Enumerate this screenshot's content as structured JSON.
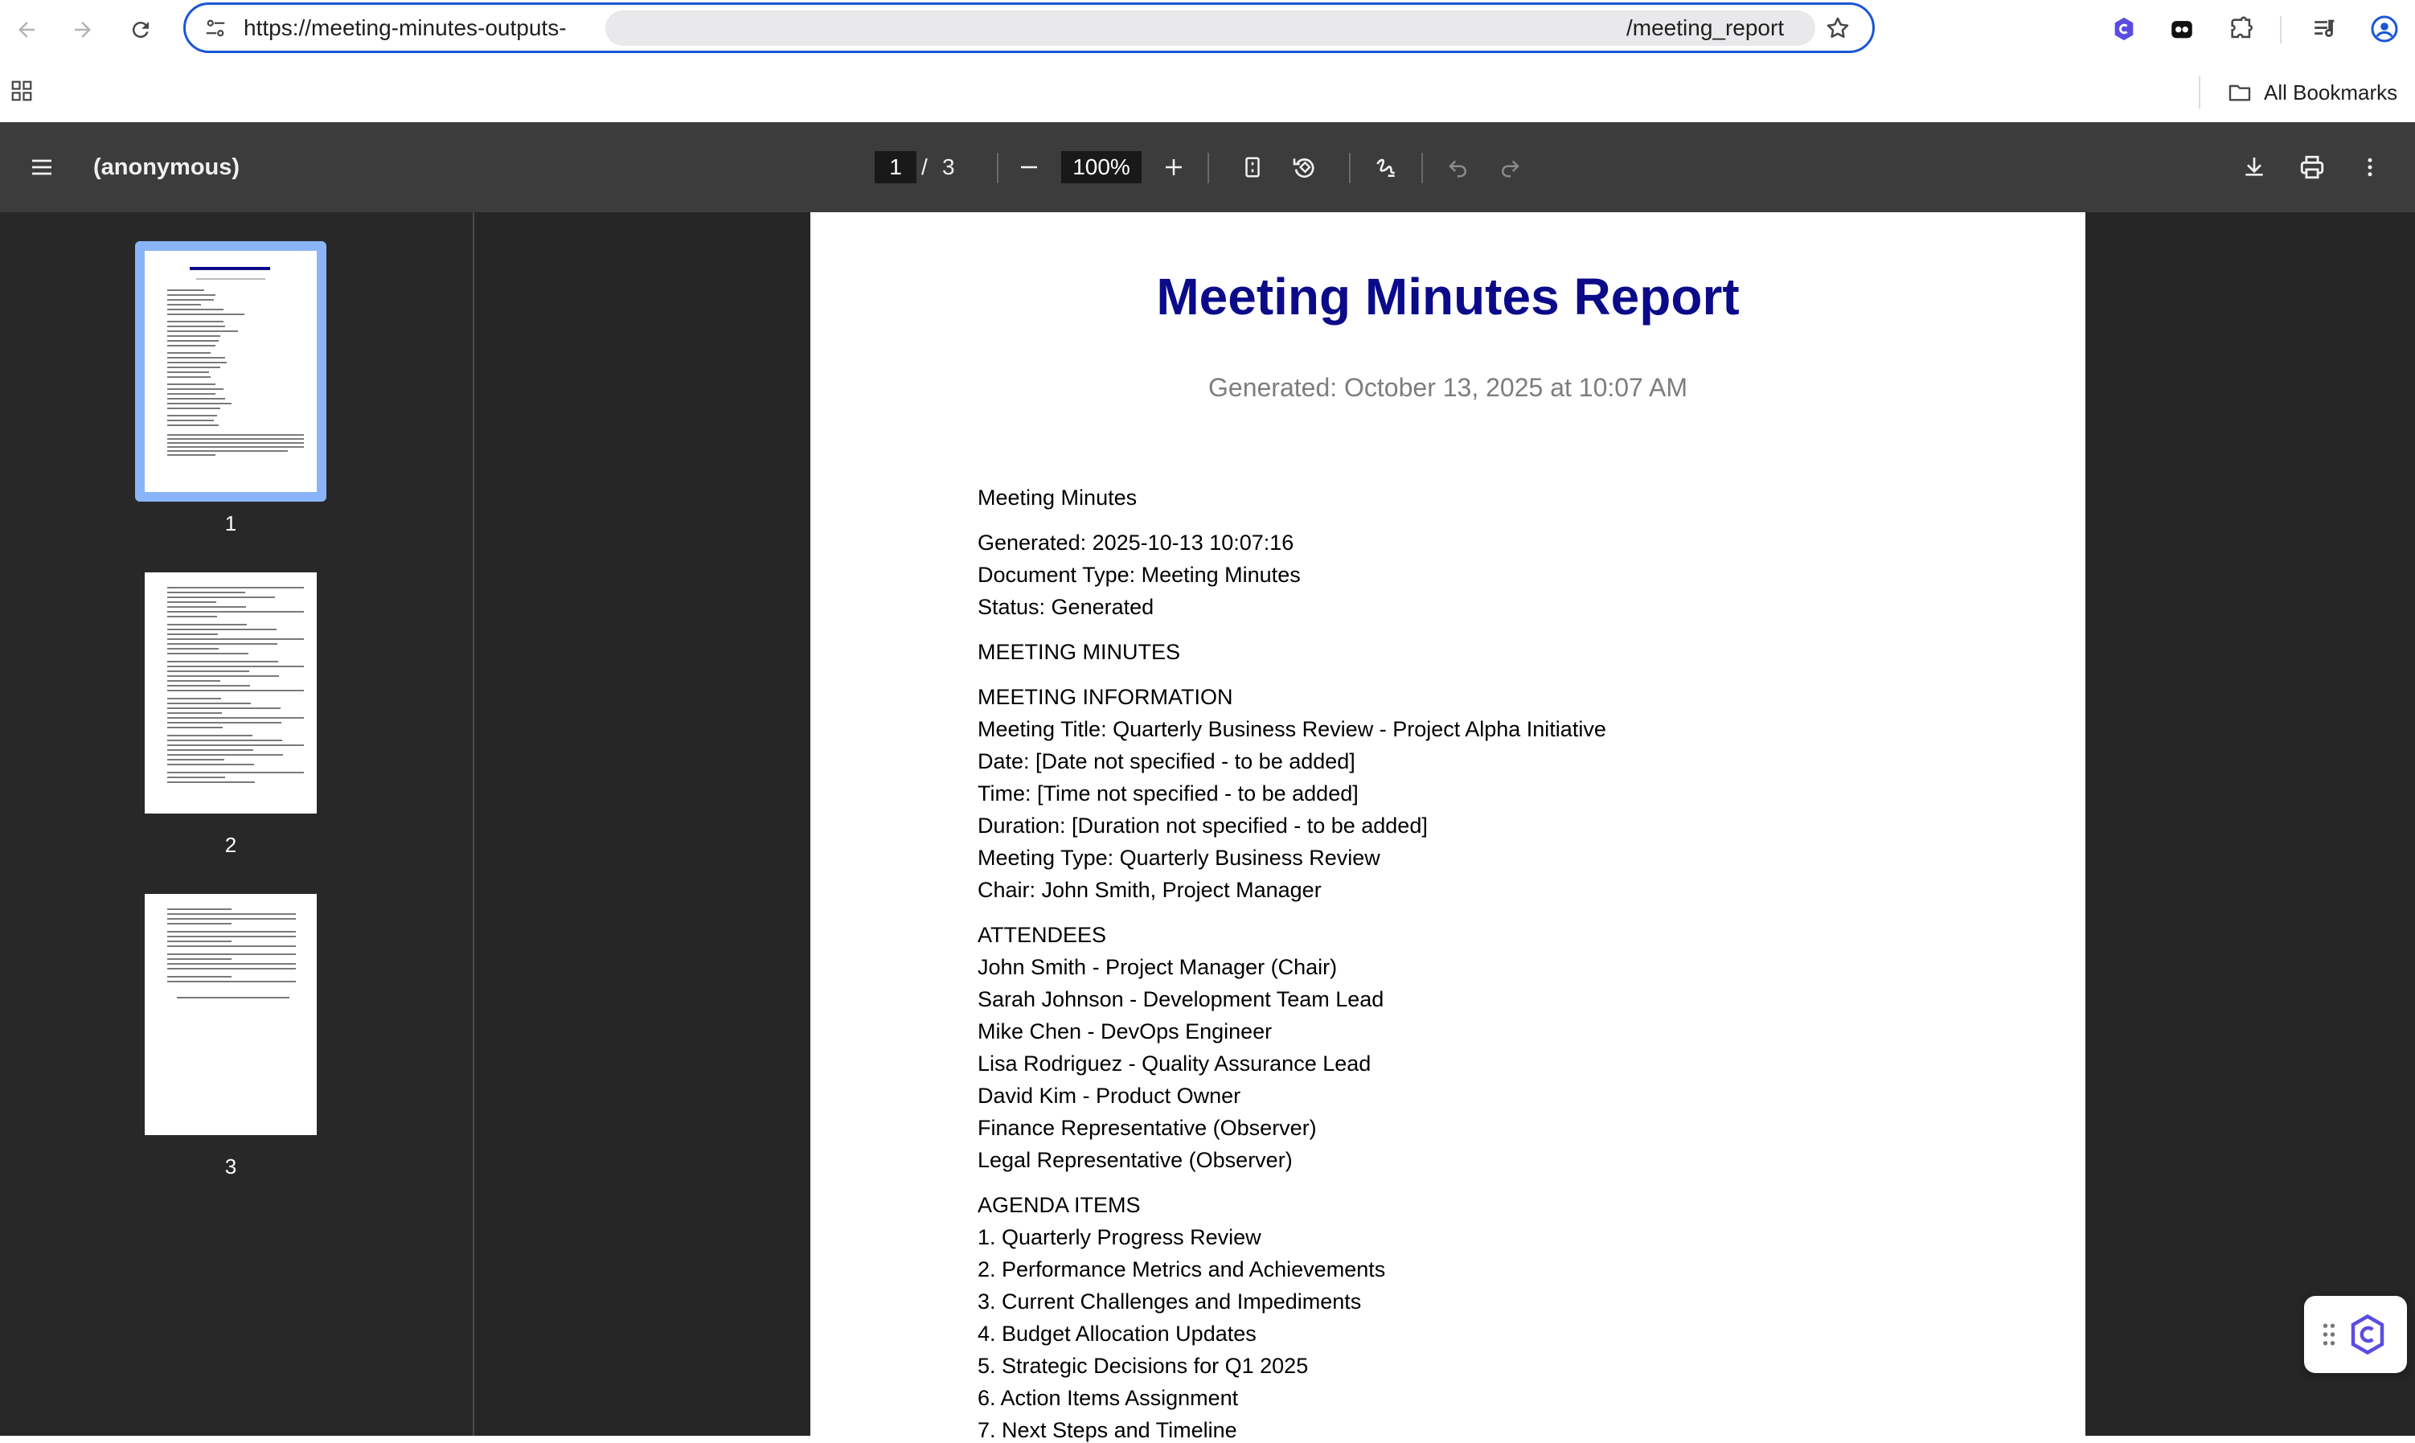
{
  "browser": {
    "url_visible_start": "https://meeting-minutes-outputs-",
    "url_visible_end": "/meeting_report",
    "bookmarks_label": "All Bookmarks"
  },
  "viewer": {
    "doc_title": "(anonymous)",
    "current_page": "1",
    "page_separator": "/",
    "total_pages": "3",
    "zoom": "100%"
  },
  "thumbnails": [
    {
      "label": "1"
    },
    {
      "label": "2"
    },
    {
      "label": "3"
    }
  ],
  "document": {
    "title": "Meeting Minutes Report",
    "generated": "Generated: October 13, 2025 at 10:07 AM",
    "lines": [
      "Meeting Minutes",
      "Generated: 2025-10-13 10:07:16",
      "Document Type: Meeting Minutes",
      "Status: Generated",
      "MEETING MINUTES",
      "MEETING INFORMATION",
      "Meeting Title: Quarterly Business Review - Project Alpha Initiative",
      "Date: [Date not specified - to be added]",
      "Time: [Time not specified - to be added]",
      "Duration: [Duration not specified - to be added]",
      "Meeting Type: Quarterly Business Review",
      "Chair: John Smith, Project Manager",
      "ATTENDEES",
      "John Smith - Project Manager (Chair)",
      "Sarah Johnson - Development Team Lead",
      "Mike Chen - DevOps Engineer",
      "Lisa Rodriguez - Quality Assurance Lead",
      "David Kim - Product Owner",
      "Finance Representative (Observer)",
      "Legal Representative (Observer)",
      "AGENDA ITEMS",
      "1. Quarterly Progress Review",
      "2. Performance Metrics and Achievements",
      "3. Current Challenges and Impediments",
      "4. Budget Allocation Updates",
      "5. Strategic Decisions for Q1 2025",
      "6. Action Items Assignment",
      "7. Next Steps and Timeline"
    ]
  },
  "colors": {
    "title_blue": "#0b0b8a",
    "focus_ring": "#1a56d6",
    "toolbar": "#3c3c3c",
    "sidebar": "#282828",
    "thumb_highlight": "#8ab4f8"
  }
}
